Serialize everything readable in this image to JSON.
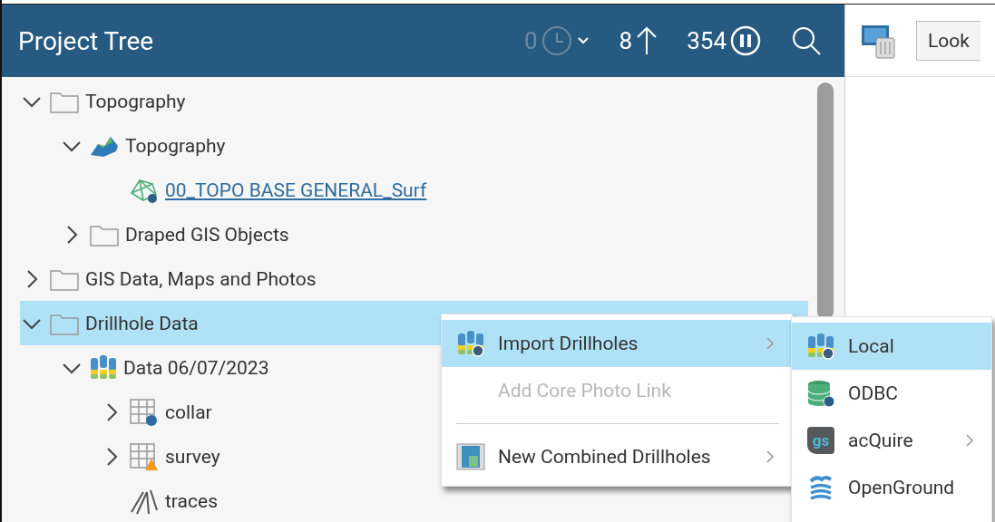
{
  "panel": {
    "title": "Project Tree",
    "pending_count": "0",
    "upload_count": "8",
    "paused_count": "354"
  },
  "tree": [
    {
      "label": "Topography",
      "kind": "folder",
      "expanded": true,
      "selected": false,
      "children": [
        {
          "label": "Topography",
          "kind": "topography",
          "expanded": true,
          "selected": false,
          "children": [
            {
              "label": "00_TOPO BASE GENERAL_Surf",
              "kind": "mesh",
              "selected": false,
              "link": true
            }
          ]
        },
        {
          "label": "Draped GIS Objects",
          "kind": "folder",
          "expanded": false,
          "selected": false
        }
      ]
    },
    {
      "label": "GIS Data, Maps and Photos",
      "kind": "folder",
      "expanded": false,
      "selected": false
    },
    {
      "label": "Drillhole Data",
      "kind": "folder",
      "expanded": true,
      "selected": true,
      "children": [
        {
          "label": "Data 06/07/2023",
          "kind": "drillholes",
          "expanded": true,
          "selected": false,
          "children": [
            {
              "label": "collar",
              "kind": "table",
              "expanded": false,
              "selected": false
            },
            {
              "label": "survey",
              "kind": "table-warning",
              "expanded": false,
              "selected": false
            },
            {
              "label": "traces",
              "kind": "traces",
              "selected": false
            }
          ]
        }
      ]
    }
  ],
  "side_toolbar": {
    "button": "Look"
  },
  "context_menu": [
    {
      "kind": "drillholes",
      "label": "Import Drillholes",
      "selected": true,
      "disabled": false,
      "submenu": true
    },
    {
      "kind": "plain",
      "label": "Add Core Photo Link",
      "selected": false,
      "disabled": true,
      "submenu": false
    },
    {
      "kind": "separator"
    },
    {
      "kind": "combined",
      "label": "New Combined Drillholes",
      "selected": false,
      "disabled": false,
      "submenu": true
    }
  ],
  "submenu": [
    {
      "kind": "drillholes",
      "label": "Local",
      "selected": true,
      "submenu": false
    },
    {
      "kind": "database",
      "label": "ODBC",
      "selected": false,
      "submenu": false
    },
    {
      "kind": "badge",
      "label": "acQuire",
      "badge": "gs",
      "selected": false,
      "submenu": true
    },
    {
      "kind": "layers",
      "label": "OpenGround",
      "selected": false,
      "submenu": false
    }
  ]
}
